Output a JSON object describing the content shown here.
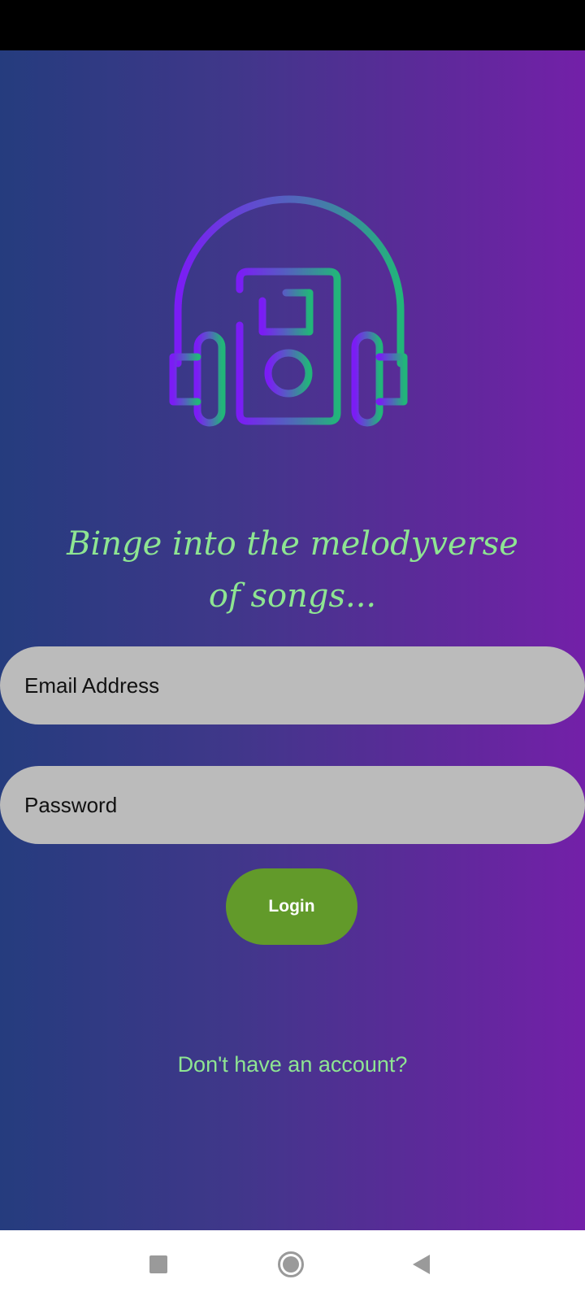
{
  "app": {
    "tagline": "Binge into the melodyverse of songs...",
    "logo_icon": "headphones-music-player-icon"
  },
  "login_form": {
    "email_placeholder": "Email Address",
    "password_placeholder": "Password",
    "login_label": "Login",
    "signup_link": "Don't have an account?"
  },
  "nav_bar": {
    "recents_icon": "square-icon",
    "home_icon": "circle-icon",
    "back_icon": "triangle-back-icon"
  },
  "colors": {
    "gradient_start": "#253c7e",
    "gradient_end": "#7320a8",
    "accent_green_text": "#8ee592",
    "input_background": "#bbbbbb",
    "login_button": "#629a2a",
    "logo_gradient_start": "#7b1cf5",
    "logo_gradient_end": "#22b57a"
  }
}
